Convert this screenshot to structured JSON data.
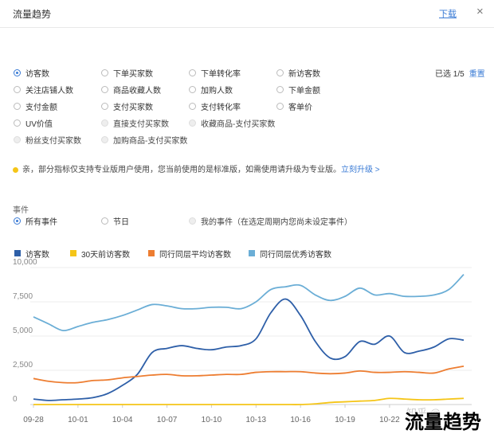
{
  "header": {
    "title": "流量趋势",
    "download_label": "下载",
    "close_label": "×"
  },
  "metrics": [
    {
      "label": "访客数",
      "checked": true,
      "disabled": false
    },
    {
      "label": "下单买家数",
      "checked": false,
      "disabled": false
    },
    {
      "label": "下单转化率",
      "checked": false,
      "disabled": false
    },
    {
      "label": "新访客数",
      "checked": false,
      "disabled": false
    },
    {
      "label": "关注店铺人数",
      "checked": false,
      "disabled": false
    },
    {
      "label": "商品收藏人数",
      "checked": false,
      "disabled": false
    },
    {
      "label": "加购人数",
      "checked": false,
      "disabled": false
    },
    {
      "label": "下单金额",
      "checked": false,
      "disabled": false
    },
    {
      "label": "支付金额",
      "checked": false,
      "disabled": false
    },
    {
      "label": "支付买家数",
      "checked": false,
      "disabled": false
    },
    {
      "label": "支付转化率",
      "checked": false,
      "disabled": false
    },
    {
      "label": "客单价",
      "checked": false,
      "disabled": false
    },
    {
      "label": "UV价值",
      "checked": false,
      "disabled": false
    },
    {
      "label": "直接支付买家数",
      "checked": false,
      "disabled": true
    },
    {
      "label": "收藏商品-支付买家数",
      "checked": false,
      "disabled": true
    },
    {
      "label": "粉丝支付买家数",
      "checked": false,
      "disabled": true
    },
    {
      "label": "加购商品-支付买家数",
      "checked": false,
      "disabled": true
    }
  ],
  "selection": {
    "count_text": "已选 1/5",
    "reset_label": "重置"
  },
  "notice": {
    "text": "亲，部分指标仅支持专业版用户使用，您当前使用的是标准版，如需使用请升级为专业版。",
    "link": "立刻升级 >"
  },
  "events": {
    "label": "事件",
    "options": [
      {
        "label": "所有事件",
        "checked": true,
        "disabled": false
      },
      {
        "label": "节日",
        "checked": false,
        "disabled": false
      },
      {
        "label": "我的事件（在选定周期内您尚未设定事件）",
        "checked": false,
        "disabled": true
      }
    ]
  },
  "watermark": {
    "text": "流量趋势",
    "zhihu": "知乎 @"
  },
  "colors": {
    "accent": "#3a7bd5"
  },
  "chart_data": {
    "type": "line",
    "x": [
      "09-28",
      "09-29",
      "09-30",
      "10-01",
      "10-02",
      "10-03",
      "10-04",
      "10-05",
      "10-06",
      "10-07",
      "10-08",
      "10-09",
      "10-10",
      "10-11",
      "10-12",
      "10-13",
      "10-14",
      "10-15",
      "10-16",
      "10-17",
      "10-18",
      "10-19",
      "10-20",
      "10-21",
      "10-22",
      "10-23",
      "10-24",
      "10-25",
      "10-26",
      "10-27"
    ],
    "xticks": [
      "09-28",
      "10-01",
      "10-04",
      "10-07",
      "10-10",
      "10-13",
      "10-16",
      "10-19",
      "10-22"
    ],
    "yticks": [
      "0",
      "2,500",
      "5,000",
      "7,500",
      "10,000"
    ],
    "ylim": [
      0,
      10000
    ],
    "series": [
      {
        "name": "访客数",
        "color": "#2e5fa8",
        "values": [
          400,
          300,
          350,
          400,
          500,
          800,
          1400,
          2200,
          3800,
          4100,
          4300,
          4100,
          4000,
          4200,
          4300,
          4800,
          6700,
          7700,
          6500,
          4600,
          3400,
          3500,
          4600,
          4400,
          5000,
          3800,
          3900,
          4200,
          4800,
          4700
        ]
      },
      {
        "name": "30天前访客数",
        "color": "#f5c518",
        "values": [
          0,
          0,
          0,
          0,
          0,
          0,
          0,
          0,
          0,
          0,
          0,
          0,
          0,
          0,
          0,
          0,
          0,
          0,
          0,
          50,
          150,
          200,
          250,
          300,
          450,
          400,
          350,
          350,
          400,
          450
        ]
      },
      {
        "name": "同行同层平均访客数",
        "color": "#ed7d31",
        "values": [
          1900,
          1700,
          1600,
          1600,
          1750,
          1800,
          1950,
          2050,
          2150,
          2200,
          2100,
          2100,
          2150,
          2200,
          2200,
          2350,
          2400,
          2400,
          2400,
          2300,
          2250,
          2300,
          2450,
          2350,
          2350,
          2400,
          2350,
          2300,
          2600,
          2800
        ]
      },
      {
        "name": "同行同层优秀访客数",
        "color": "#6baed6",
        "values": [
          6400,
          5900,
          5400,
          5700,
          6000,
          6200,
          6500,
          6900,
          7300,
          7200,
          7000,
          7000,
          7100,
          7100,
          7000,
          7500,
          8400,
          8600,
          8700,
          8000,
          7600,
          7900,
          8500,
          8000,
          8100,
          7900,
          7900,
          8000,
          8400,
          9500
        ]
      }
    ]
  }
}
